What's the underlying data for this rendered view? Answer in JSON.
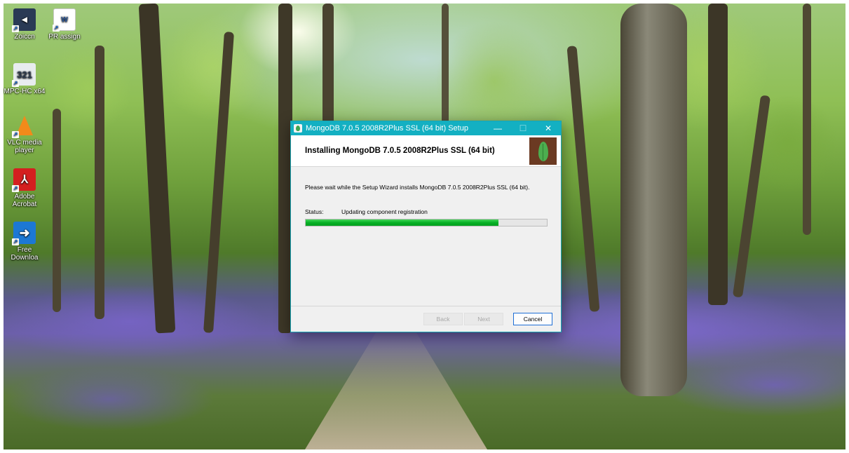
{
  "desktop": {
    "icons": [
      {
        "label": "Zoiccn",
        "icon": "app-shortcut-icon",
        "color": "#2a3a55"
      },
      {
        "label": "PR assign",
        "icon": "word-document-icon",
        "color": "#2b5797"
      },
      {
        "label": "MPC-HC x64",
        "icon": "mpc-hc-icon",
        "color": "#2e3b4e"
      },
      {
        "label": "VLC media player",
        "icon": "vlc-cone-icon",
        "color": "#f28a1a"
      },
      {
        "label": "Adobe Acrobat",
        "icon": "adobe-acrobat-icon",
        "color": "#d41f1f"
      },
      {
        "label": "Free Downloa",
        "icon": "free-download-manager-icon",
        "color": "#1c78d4"
      }
    ]
  },
  "window": {
    "title": "MongoDB 7.0.5 2008R2Plus SSL (64 bit) Setup",
    "controls": {
      "minimize": "—",
      "maximize": "☐",
      "close": "✕"
    },
    "heading": "Installing MongoDB 7.0.5 2008R2Plus SSL (64 bit)",
    "description": "Please wait while the Setup Wizard installs MongoDB 7.0.5 2008R2Plus SSL (64 bit).",
    "status_label": "Status:",
    "status_value": "Updating component registration",
    "progress_fraction": 0.8,
    "buttons": {
      "back": "Back",
      "next": "Next",
      "cancel": "Cancel"
    },
    "colors": {
      "titlebar": "#13b0c2",
      "progress": "#06b025",
      "logo_bg": "#6b3a22",
      "leaf": "#4cae4f"
    }
  }
}
